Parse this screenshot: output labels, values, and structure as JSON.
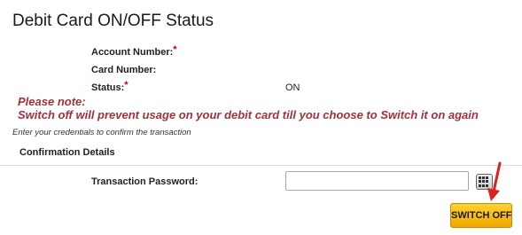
{
  "page": {
    "title": "Debit Card ON/OFF Status"
  },
  "fields": {
    "account_number_label": "Account Number:",
    "card_number_label": "Card Number:",
    "status_label": "Status:",
    "status_value": "ON",
    "required_marker": "*"
  },
  "note": {
    "line1": "Please note:",
    "line2": "Switch off will prevent usage on your debit card till you choose to Switch it on again"
  },
  "hint": "Enter your credentials to confirm the transaction",
  "confirmation": {
    "section_title": "Confirmation Details",
    "password_label": "Transaction Password:",
    "password_value": ""
  },
  "actions": {
    "switch_off_label": "SWITCH OFF"
  },
  "colors": {
    "note": "#a0323e",
    "required": "#cc0000",
    "button": "#f5b800",
    "arrow": "#e02020"
  },
  "icons": {
    "keypad": "virtual-keypad-icon",
    "arrow": "red-arrow-icon"
  }
}
